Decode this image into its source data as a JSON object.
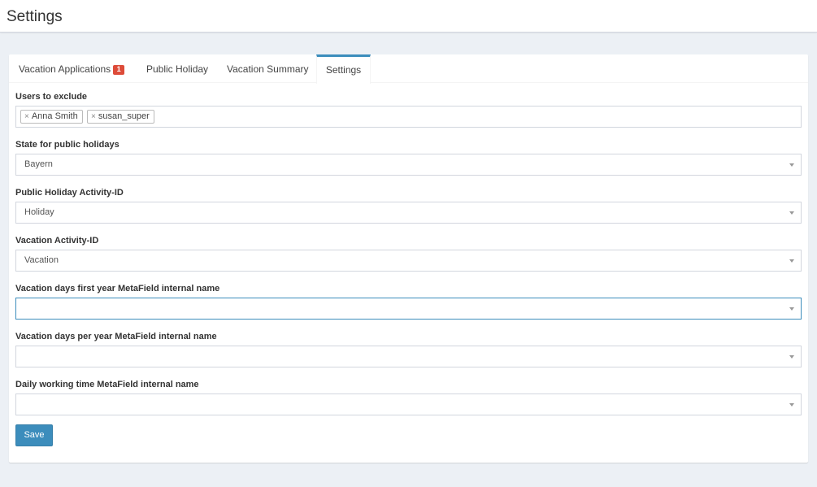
{
  "header": {
    "title": "Settings"
  },
  "tabs": [
    {
      "label": "Vacation Applications",
      "badge": "1"
    },
    {
      "label": "Public Holiday"
    },
    {
      "label": "Vacation Summary"
    },
    {
      "label": "Settings",
      "active": true
    }
  ],
  "form": {
    "users_exclude": {
      "label": "Users to exclude",
      "tags": [
        "Anna Smith",
        "susan_super"
      ],
      "remove_glyph": "×"
    },
    "state_holidays": {
      "label": "State for public holidays",
      "value": "Bayern"
    },
    "public_holiday_activity": {
      "label": "Public Holiday Activity-ID",
      "value": "Holiday"
    },
    "vacation_activity": {
      "label": "Vacation Activity-ID",
      "value": "Vacation"
    },
    "vacation_days_first_year": {
      "label": "Vacation days first year MetaField internal name",
      "value": ""
    },
    "vacation_days_per_year": {
      "label": "Vacation days per year MetaField internal name",
      "value": ""
    },
    "daily_working_time": {
      "label": "Daily working time MetaField internal name",
      "value": ""
    },
    "save_label": "Save"
  },
  "colors": {
    "accent": "#3c8dbc",
    "badge": "#dd4b39",
    "background": "#ecf0f5"
  }
}
